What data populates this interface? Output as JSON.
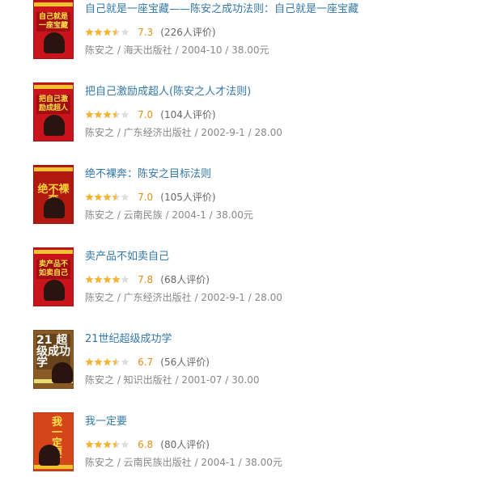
{
  "colors": {
    "link": "#3377aa",
    "star": "#f3b430",
    "star_empty": "#dddddd",
    "meta": "#888888"
  },
  "books": [
    {
      "cover_icon": "book-cover-icon",
      "cover_text": "自己就是一座宝藏",
      "title": "自己就是一座宝藏——陈安之成功法则：自己就是一座宝藏",
      "stars": 3.5,
      "score": "7.3",
      "count": "(226人评价)",
      "publisher": "陈安之 / 海天出版社 / 2004-10 / 38.00元"
    },
    {
      "cover_icon": "book-cover-icon",
      "cover_text": "把自己激励成超人",
      "title": "把自己激励成超人(陈安之人才法则)",
      "stars": 3.5,
      "score": "7.0",
      "count": "(104人评价)",
      "publisher": "陈安之 / 广东经济出版社 / 2002-9-1 / 28.00"
    },
    {
      "cover_icon": "book-cover-icon",
      "cover_text": "绝不裸奔",
      "title": "绝不裸奔：陈安之目标法则",
      "stars": 3.5,
      "score": "7.0",
      "count": "(105人评价)",
      "publisher": "陈安之 / 云南民族 / 2004-1 / 38.00元"
    },
    {
      "cover_icon": "book-cover-icon",
      "cover_text": "卖产品不如卖自己",
      "title": "卖产品不如卖自己",
      "stars": 4,
      "score": "7.8",
      "count": "(68人评价)",
      "publisher": "陈安之 / 广东经济出版社 / 2002-9-1 / 28.00"
    },
    {
      "cover_icon": "book-cover-icon",
      "cover_text": "21 超级成功学",
      "title": "21世纪超级成功学",
      "stars": 3.5,
      "score": "6.7",
      "count": "(56人评价)",
      "publisher": "陈安之 / 知识出版社 / 2001-07 / 30.00"
    },
    {
      "cover_icon": "book-cover-icon",
      "cover_text": "我一定要",
      "title": "我一定要",
      "stars": 3.5,
      "score": "6.8",
      "count": "(80人评价)",
      "publisher": "陈安之 / 云南民族出版社 / 2004-1 / 38.00元"
    }
  ]
}
